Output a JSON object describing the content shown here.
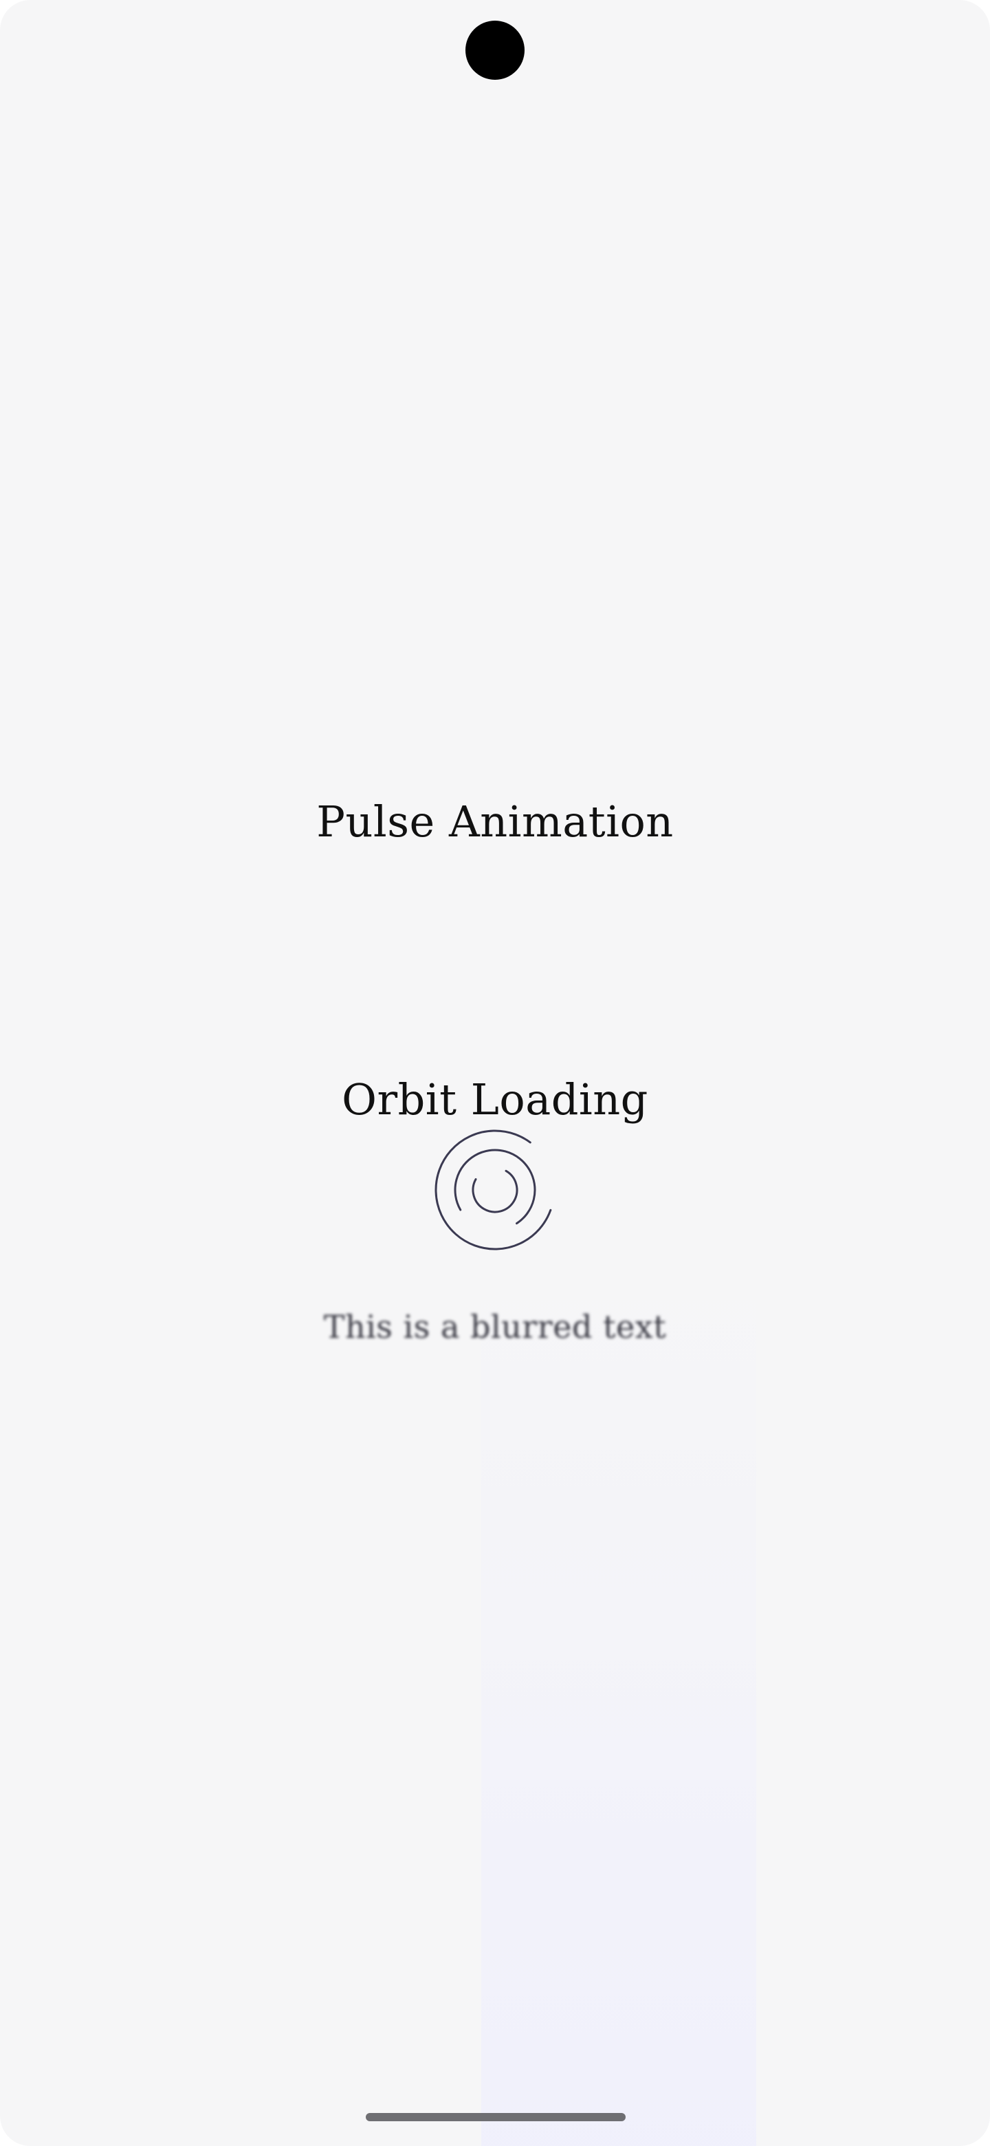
{
  "screen": {
    "sections": {
      "pulse": {
        "title": "Pulse Animation"
      },
      "orbit": {
        "title": "Orbit Loading",
        "loader_color": "#3b3a52"
      },
      "blur": {
        "text": "This is a blurred text"
      }
    }
  },
  "colors": {
    "background": "#f6f6f7",
    "text": "#111111",
    "home_indicator": "#6f6f73"
  },
  "icons": {
    "camera": "front-camera-punch-hole",
    "loader": "orbit-spinner-icon"
  }
}
